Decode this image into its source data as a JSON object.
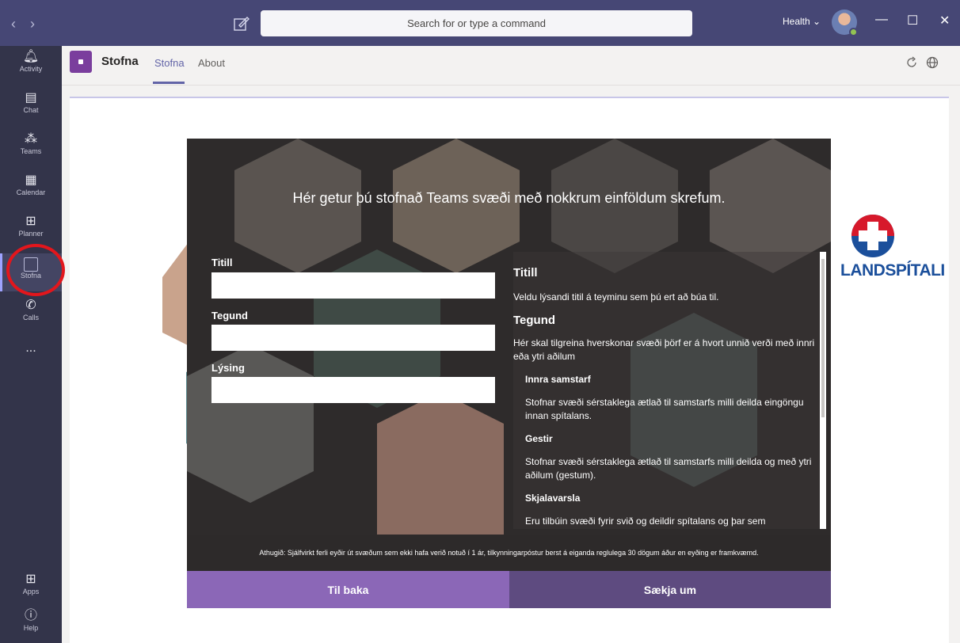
{
  "titlebar": {
    "search_placeholder": "Search for or type a command",
    "tenant": "Health"
  },
  "appbar": {
    "items": [
      {
        "label": "Activity",
        "icon": "bell-icon"
      },
      {
        "label": "Chat",
        "icon": "chat-icon"
      },
      {
        "label": "Teams",
        "icon": "teams-icon"
      },
      {
        "label": "Calendar",
        "icon": "calendar-icon"
      },
      {
        "label": "Planner",
        "icon": "planner-icon"
      },
      {
        "label": "Stofna",
        "icon": "app-square-icon",
        "active": true
      },
      {
        "label": "Calls",
        "icon": "phone-icon"
      },
      {
        "label": "...",
        "icon": "more-icon"
      }
    ],
    "bottom": [
      {
        "label": "Apps",
        "icon": "apps-icon"
      },
      {
        "label": "Help",
        "icon": "help-icon"
      }
    ]
  },
  "header": {
    "app_name": "Stofna",
    "tabs": [
      {
        "label": "Stofna",
        "active": true
      },
      {
        "label": "About"
      }
    ]
  },
  "hero": {
    "title": "Hér getur þú stofnað Teams svæði með nokkrum einföldum skrefum.",
    "fields": [
      {
        "label": "Titill",
        "value": ""
      },
      {
        "label": "Tegund",
        "value": ""
      },
      {
        "label": "Lýsing",
        "value": ""
      }
    ],
    "info": {
      "h1": "Titill",
      "p1": "Veldu lýsandi titil á teyminu sem þú ert að búa til.",
      "h2": "Tegund",
      "p2": "Hér skal tilgreina hverskonar svæði þörf er á hvort unnið verði með innri eða ytri aðilum",
      "s1": "Innra samstarf",
      "s1_text": "Stofnar svæði sérstaklega ætlað til samstarfs milli deilda eingöngu innan spítalans.",
      "s2": "Gestir",
      "s2_text": "Stofnar svæði sérstaklega ætlað til samstarfs milli deilda og með ytri aðilum (gestum).",
      "s3": "Skjalavarsla",
      "s3_text": "Eru tilbúin svæði fyrir svið og deildir spítalans og þar sem"
    },
    "notice": "Athugið: Sjálfvirkt ferli eyðir út svæðum sem ekki hafa verið notuð í 1 ár, tilkynningarpóstur berst á eiganda reglulega 30 dögum áður en eyðing er framkvæmd."
  },
  "logo_text": "LANDSPÍTALI",
  "buttons": {
    "back": "Til baka",
    "apply": "Sækja um"
  }
}
